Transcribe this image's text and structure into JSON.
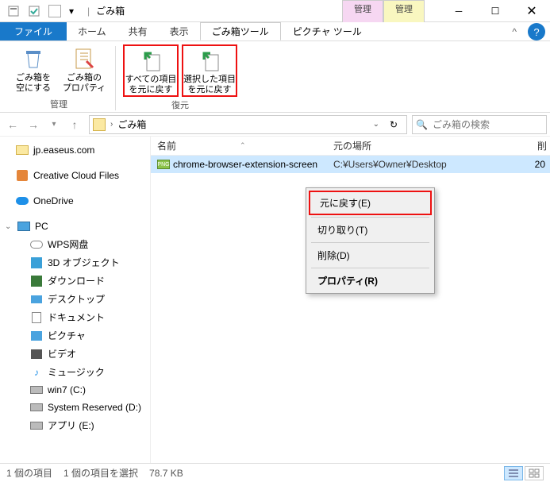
{
  "title": "ごみ箱",
  "context_tabs": {
    "manage1": "管理",
    "manage2": "管理",
    "sub1": "ごみ箱ツール",
    "sub2": "ピクチャ ツール"
  },
  "ribbon_tabs": {
    "file": "ファイル",
    "home": "ホーム",
    "share": "共有",
    "view": "表示"
  },
  "ribbon": {
    "manage_group": "管理",
    "restore_group": "復元",
    "empty": "ごみ箱を\n空にする",
    "props": "ごみ箱の\nプロパティ",
    "restore_all": "すべての項目\nを元に戻す",
    "restore_sel": "選択した項目\nを元に戻す"
  },
  "address": {
    "location": "ごみ箱"
  },
  "search": {
    "placeholder": "ごみ箱の検索"
  },
  "columns": {
    "name": "名前",
    "loc": "元の場所",
    "date_prefix": "削"
  },
  "file": {
    "name": "chrome-browser-extension-screen",
    "loc": "C:¥Users¥Owner¥Desktop",
    "date": "20",
    "icon_label": "PNG"
  },
  "context_menu": {
    "restore": "元に戻す(E)",
    "cut": "切り取り(T)",
    "delete": "削除(D)",
    "properties": "プロパティ(R)"
  },
  "sidebar": {
    "easeus": "jp.easeus.com",
    "ccf": "Creative Cloud Files",
    "onedrive": "OneDrive",
    "pc": "PC",
    "wps": "WPS网盘",
    "threed": "3D オブジェクト",
    "downloads": "ダウンロード",
    "desktop": "デスクトップ",
    "documents": "ドキュメント",
    "pictures": "ピクチャ",
    "videos": "ビデオ",
    "music": "ミュージック",
    "win7": "win7 (C:)",
    "sysres": "System Reserved (D:)",
    "apps": "アプリ (E:)"
  },
  "status": {
    "count": "1 個の項目",
    "selected": "1 個の項目を選択",
    "size": "78.7 KB"
  }
}
